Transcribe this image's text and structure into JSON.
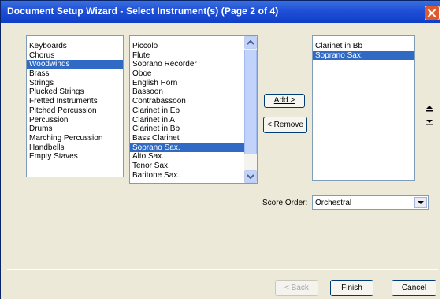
{
  "window": {
    "title": "Document Setup Wizard - Select Instrument(s) (Page 2 of 4)"
  },
  "families": {
    "items": [
      "Keyboards",
      "Chorus",
      "Woodwinds",
      "Brass",
      "Strings",
      "Plucked Strings",
      "Fretted Instruments",
      "Pitched Percussion",
      "Percussion",
      "Drums",
      "Marching Percussion",
      "Handbells",
      "Empty Staves"
    ],
    "selected": "Woodwinds"
  },
  "instruments": {
    "items": [
      "Piccolo",
      "Flute",
      "Soprano Recorder",
      "Oboe",
      "English Horn",
      "Bassoon",
      "Contrabassoon",
      "Clarinet in Eb",
      "Clarinet in A",
      "Clarinet in Bb",
      "Bass Clarinet",
      "Soprano Sax.",
      "Alto Sax.",
      "Tenor Sax.",
      "Baritone Sax."
    ],
    "selected": "Soprano Sax."
  },
  "buttons": {
    "add": "Add >",
    "remove": "< Remove",
    "back": "< Back",
    "finish": "Finish",
    "cancel": "Cancel"
  },
  "chosen": {
    "items": [
      "Clarinet in Bb",
      "Soprano Sax."
    ],
    "selected": "Soprano Sax."
  },
  "score_order": {
    "label": "Score Order:",
    "value": "Orchestral"
  },
  "colors": {
    "selection": "#316ac5",
    "titlebar": "#0f3fc7",
    "dialog_bg": "#ece9d8"
  }
}
